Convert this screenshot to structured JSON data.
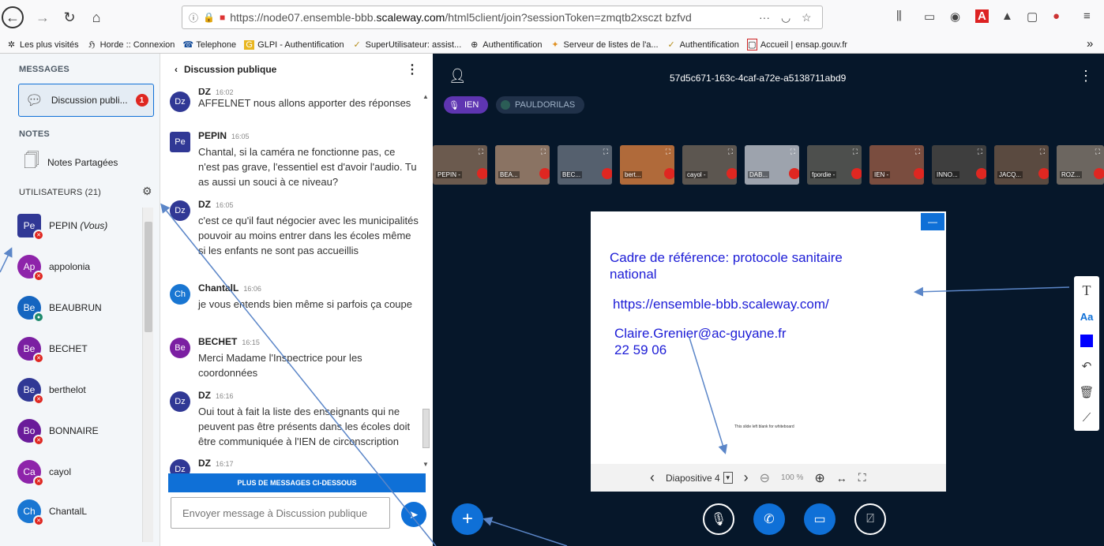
{
  "browser": {
    "url_prefix": "https://node07.ensemble-bbb.",
    "url_host": "scaleway.com",
    "url_suffix": "/html5client/join?sessionToken=zmqtb2xsczt bzfvd",
    "bookmarks": [
      {
        "icon": "gear-icon",
        "label": "Les plus visités"
      },
      {
        "icon": "horde-icon",
        "label": "Horde :: Connexion"
      },
      {
        "icon": "phone-icon",
        "label": "Telephone"
      },
      {
        "icon": "glpi-icon",
        "label": "GLPI - Authentification"
      },
      {
        "icon": "bird-icon",
        "label": "SuperUtilisateur: assist..."
      },
      {
        "icon": "globe-icon",
        "label": "Authentification"
      },
      {
        "icon": "list-icon",
        "label": "Serveur de listes de l'a..."
      },
      {
        "icon": "bird-icon",
        "label": "Authentification"
      },
      {
        "icon": "ensap-icon",
        "label": "Accueil | ensap.gouv.fr"
      }
    ],
    "more": "»"
  },
  "sidebar": {
    "messages_title": "MESSAGES",
    "public_chat_label": "Discussion publi...",
    "public_chat_badge": "1",
    "notes_title": "NOTES",
    "notes_label": "Notes Partagées",
    "users_title": "UTILISATEURS (21)",
    "users": [
      {
        "initials": "Pe",
        "name": "PEPIN",
        "suffix": "(Vous)",
        "color": "#303895"
      },
      {
        "initials": "Ap",
        "name": "appolonia",
        "suffix": "",
        "color": "#8e24aa"
      },
      {
        "initials": "Be",
        "name": "BEAUBRUN",
        "suffix": "",
        "color": "#1565c0"
      },
      {
        "initials": "Be",
        "name": "BECHET",
        "suffix": "",
        "color": "#7b1fa2"
      },
      {
        "initials": "Be",
        "name": "berthelot",
        "suffix": "",
        "color": "#303895"
      },
      {
        "initials": "Bo",
        "name": "BONNAIRE",
        "suffix": "",
        "color": "#6a1b9a"
      },
      {
        "initials": "Ca",
        "name": "cayol",
        "suffix": "",
        "color": "#8e24aa"
      },
      {
        "initials": "Ch",
        "name": "ChantalL",
        "suffix": "",
        "color": "#1976d2"
      }
    ]
  },
  "chat": {
    "title": "Discussion publique",
    "messages": [
      {
        "initials": "Dz",
        "name": "DZ",
        "time": "16:02",
        "text": "AFFELNET nous allons apporter des réponses",
        "color": "#303895"
      },
      {
        "initials": "Pe",
        "name": "PEPIN",
        "time": "16:05",
        "text": "Chantal, si la caméra ne fonctionne pas, ce n'est pas grave, l'essentiel est d'avoir l'audio. Tu as aussi un souci à ce niveau?",
        "color": "#303895"
      },
      {
        "initials": "Dz",
        "name": "DZ",
        "time": "16:05",
        "text": "c'est ce qu'il faut négocier avec les municipalités pouvoir au moins entrer dans les écoles même si les enfants ne sont pas accueillis",
        "color": "#303895"
      },
      {
        "initials": "Ch",
        "name": "ChantalL",
        "time": "16:06",
        "text": "je vous entends bien même si parfois ça coupe",
        "color": "#1976d2"
      },
      {
        "initials": "Be",
        "name": "BECHET",
        "time": "16:15",
        "text": "Merci Madame l'Inspectrice pour les coordonnées",
        "color": "#7b1fa2"
      },
      {
        "initials": "Dz",
        "name": "DZ",
        "time": "16:16",
        "text": "Oui tout à fait la liste des enseignants qui ne peuvent pas être présents dans les écoles doit être communiquée à l'IEN de circonscription",
        "color": "#303895"
      },
      {
        "initials": "Dz",
        "name": "DZ",
        "time": "16:17",
        "text": "",
        "color": "#303895"
      }
    ],
    "more_button": "PLUS DE MESSAGES CI-DESSOUS",
    "input_placeholder": "Envoyer message à Discussion publique"
  },
  "main": {
    "meeting_id": "57d5c671-163c-4caf-a72e-a5138711abd9",
    "talkers": [
      {
        "name": "IEN",
        "active": true
      },
      {
        "name": "PAULDORILAS",
        "active": false
      }
    ],
    "videos": [
      {
        "name": "PEPIN -",
        "color": "#6b5a4e"
      },
      {
        "name": "BEA...",
        "color": "#8a7363"
      },
      {
        "name": "BEC...",
        "color": "#55606e"
      },
      {
        "name": "bert...",
        "color": "#b06a3a"
      },
      {
        "name": "cayol -",
        "color": "#5c5650"
      },
      {
        "name": "DAB...",
        "color": "#9da3ad"
      },
      {
        "name": "fpordie -",
        "color": "#4d4f4d"
      },
      {
        "name": "IEN -",
        "color": "#7a4d3f"
      },
      {
        "name": "INNO...",
        "color": "#3e3e3e"
      },
      {
        "name": "JACQ...",
        "color": "#5a4a40"
      },
      {
        "name": "ROZ...",
        "color": "#6c6660"
      }
    ],
    "slide": {
      "line1": "Cadre de référence: protocole sanitaire",
      "line2": "national",
      "link": "https://ensemble-bbb.scaleway.com/",
      "email": "Claire.Grenier@ac-guyane.fr",
      "phone": "22 59 06",
      "blank_note": "This slide left blank for whiteboard",
      "nav_label": "Diapositive 4",
      "zoom": "100 %"
    }
  }
}
